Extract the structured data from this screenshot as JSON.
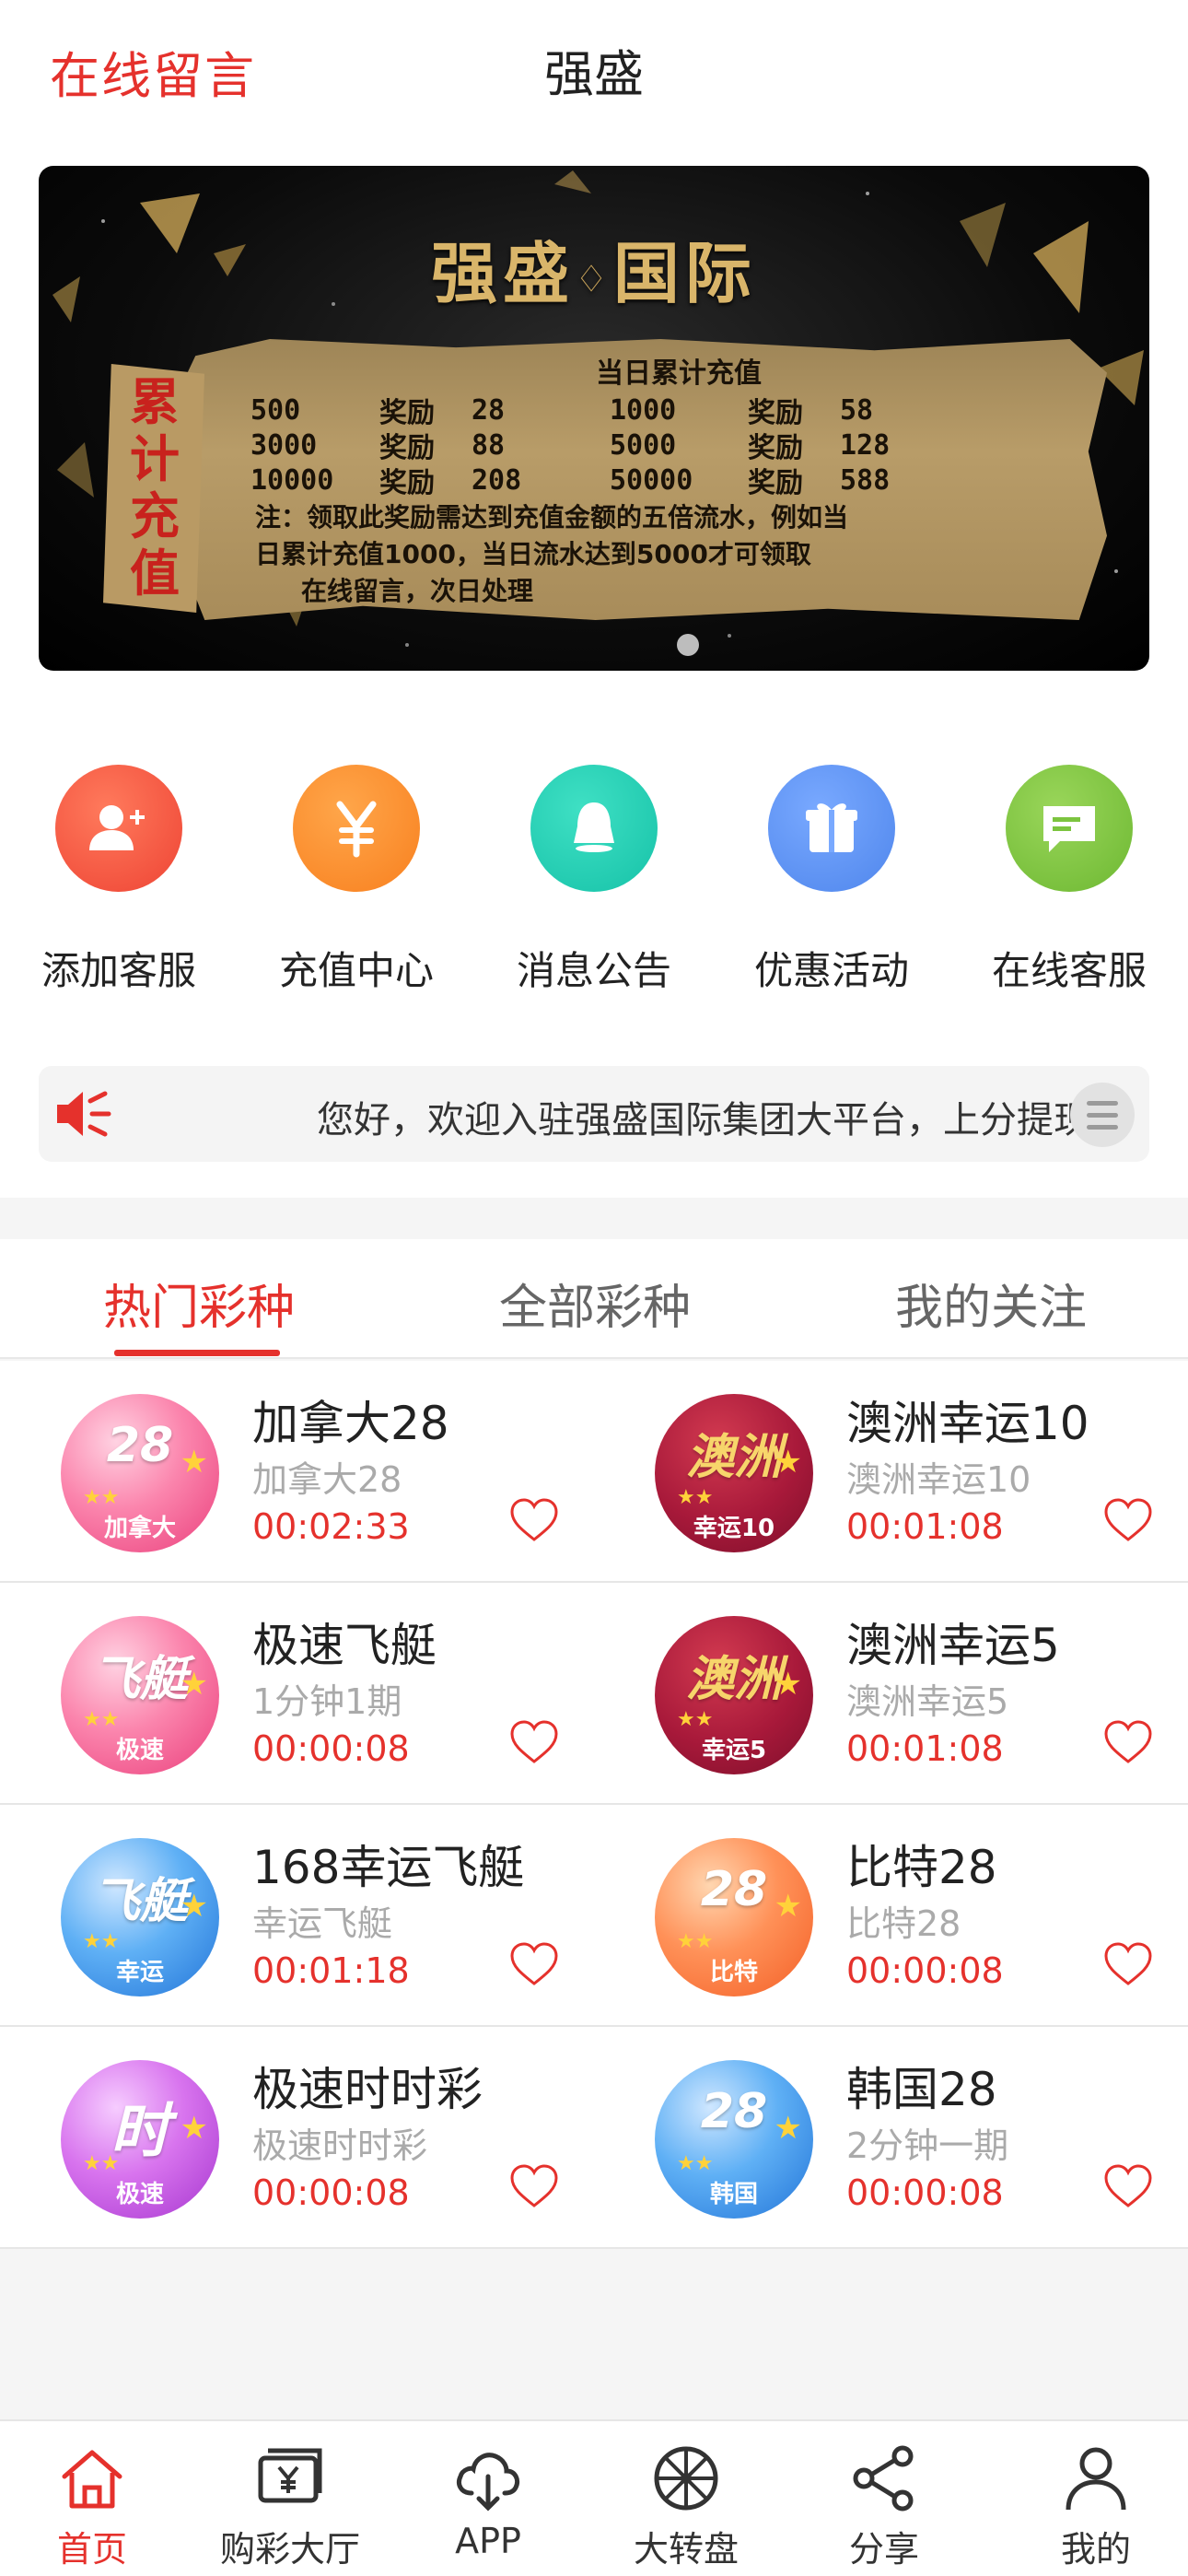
{
  "header": {
    "left_link": "在线留言",
    "title": "强盛"
  },
  "banner": {
    "title_left": "强盛",
    "title_right": "国际",
    "side_text": [
      "累",
      "计",
      "充",
      "值"
    ],
    "heading": "当日累计充值",
    "rows": [
      [
        "500",
        "奖励",
        "28",
        "1000",
        "奖励",
        "58"
      ],
      [
        "3000",
        "奖励",
        "88",
        "5000",
        "奖励",
        "128"
      ],
      [
        "10000",
        "奖励",
        "208",
        "50000",
        "奖励",
        "588"
      ]
    ],
    "note": [
      "注：领取此奖励需达到充值金额的五倍流水，例如当",
      "日累计充值1000，当日流水达到5000才可领取",
      "在线留言，次日处理"
    ]
  },
  "shortcuts": [
    {
      "label": "添加客服",
      "icon": "add-user-icon",
      "color": "#f2543d"
    },
    {
      "label": "充值中心",
      "icon": "yen-icon",
      "color": "#f98b2b"
    },
    {
      "label": "消息公告",
      "icon": "bell-icon",
      "color": "#22cbb2"
    },
    {
      "label": "优惠活动",
      "icon": "gift-icon",
      "color": "#5c94f2"
    },
    {
      "label": "在线客服",
      "icon": "chat-icon",
      "color": "#79c23d"
    }
  ],
  "notice": {
    "text": "您好，欢迎入驻强盛国际集团大平台，上分提现秒到账"
  },
  "tabs": [
    "热门彩种",
    "全部彩种",
    "我的关注"
  ],
  "games": [
    {
      "name": "加拿大28",
      "sub": "加拿大28",
      "time": "00:02:33",
      "badge_top": "28",
      "badge_bottom": "加拿大",
      "style": "pink"
    },
    {
      "name": "澳洲幸运10",
      "sub": "澳洲幸运10",
      "time": "00:01:08",
      "badge_top": "澳洲",
      "badge_bottom": "幸运10",
      "style": "crimson"
    },
    {
      "name": "极速飞艇",
      "sub": "1分钟1期",
      "time": "00:00:08",
      "badge_top": "飞艇",
      "badge_bottom": "极速",
      "style": "pink"
    },
    {
      "name": "澳洲幸运5",
      "sub": "澳洲幸运5",
      "time": "00:01:08",
      "badge_top": "澳洲",
      "badge_bottom": "幸运5",
      "style": "crimson"
    },
    {
      "name": "168幸运飞艇",
      "sub": "幸运飞艇",
      "time": "00:01:18",
      "badge_top": "飞艇",
      "badge_bottom": "幸运",
      "style": "blue"
    },
    {
      "name": "比特28",
      "sub": "比特28",
      "time": "00:00:08",
      "badge_top": "28",
      "badge_bottom": "比特",
      "style": "orange"
    },
    {
      "name": "极速时时彩",
      "sub": "极速时时彩",
      "time": "00:00:08",
      "badge_top": "时",
      "badge_bottom": "极速",
      "style": "purple"
    },
    {
      "name": "韩国28",
      "sub": "2分钟一期",
      "time": "00:00:08",
      "badge_top": "28",
      "badge_bottom": "韩国",
      "style": "blue"
    }
  ],
  "tabbar": [
    {
      "label": "首页",
      "icon": "home-icon"
    },
    {
      "label": "购彩大厅",
      "icon": "ticket-icon"
    },
    {
      "label": "APP",
      "icon": "cloud-download-icon"
    },
    {
      "label": "大转盘",
      "icon": "wheel-icon"
    },
    {
      "label": "分享",
      "icon": "share-icon"
    },
    {
      "label": "我的",
      "icon": "user-icon"
    }
  ],
  "colors": {
    "accent": "#e5312c",
    "gold": "#d9b56a"
  }
}
